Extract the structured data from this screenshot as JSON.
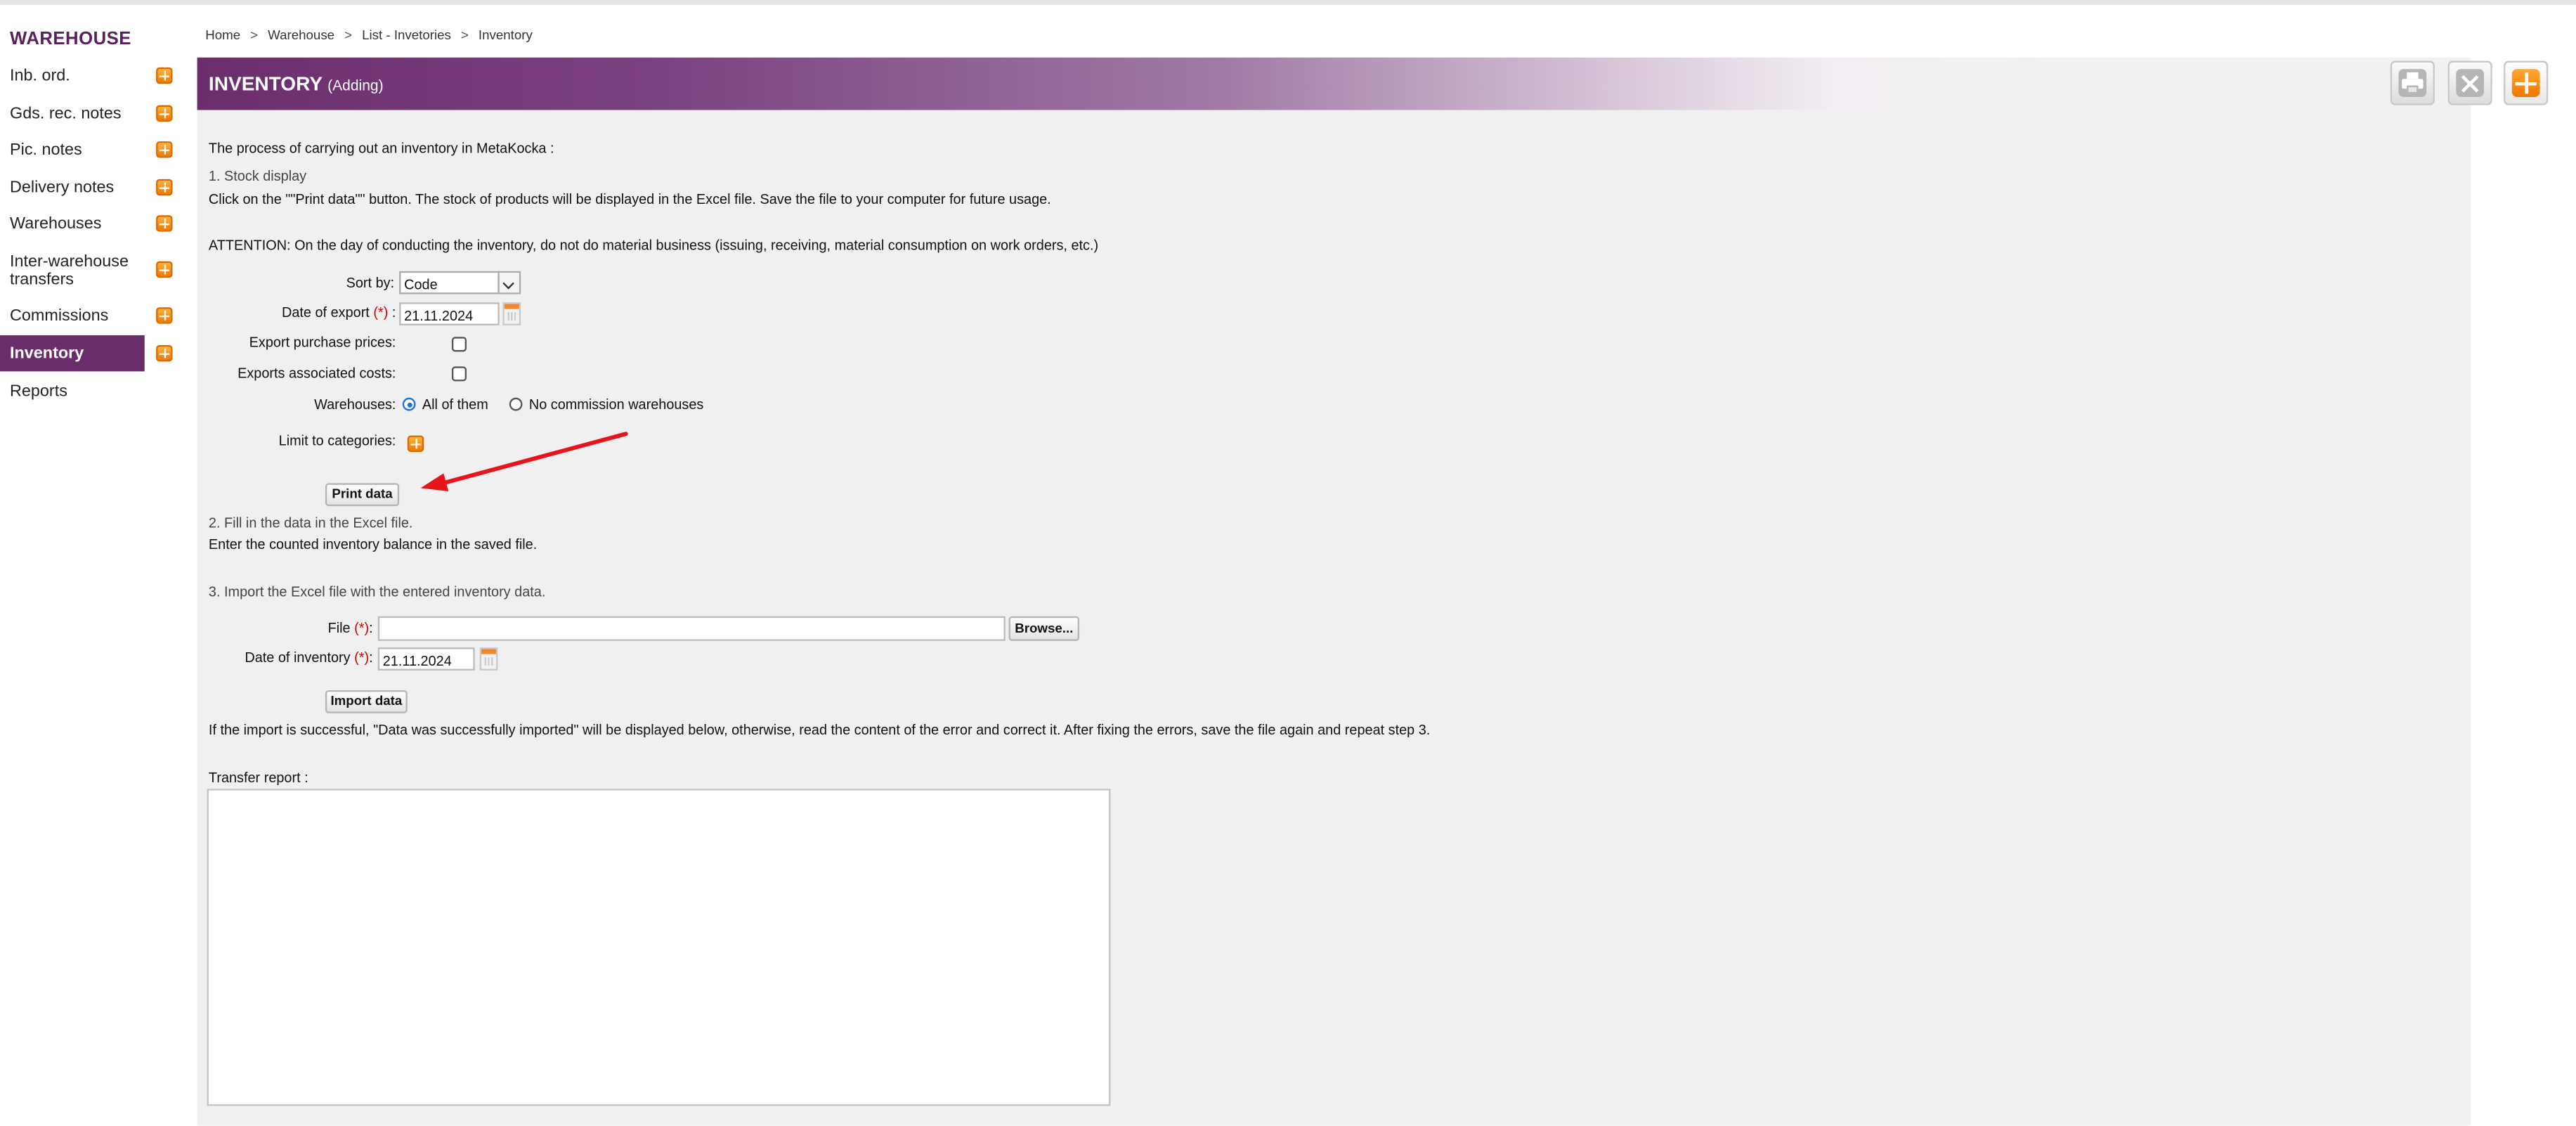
{
  "sidebar": {
    "title": "WAREHOUSE",
    "items": [
      {
        "label": "Inb. ord.",
        "has_add": true
      },
      {
        "label": "Gds. rec. notes",
        "has_add": true
      },
      {
        "label": "Pic. notes",
        "has_add": true
      },
      {
        "label": "Delivery notes",
        "has_add": true
      },
      {
        "label": "Warehouses",
        "has_add": true
      },
      {
        "label": "Inter-warehouse",
        "label2": "transfers",
        "has_add": true
      },
      {
        "label": "Commissions",
        "has_add": true
      },
      {
        "label": "Inventory",
        "has_add": true,
        "active": true
      },
      {
        "label": "Reports",
        "has_add": false
      }
    ]
  },
  "breadcrumb": {
    "items": [
      "Home",
      "Warehouse",
      "List - Invetories",
      "Inventory"
    ],
    "separator": ">"
  },
  "header": {
    "title": "INVENTORY",
    "subtitle": "(Adding)"
  },
  "toolbar": {
    "buttons": [
      "printer-icon",
      "close-icon",
      "add-icon"
    ]
  },
  "content": {
    "intro": "The process of carrying out an inventory in MetaKocka :",
    "step1_title": "1. Stock display",
    "step1_text": "Click on the \"\"Print data\"\" button. The stock of products will be displayed in the Excel file. Save the file to your computer for future usage.",
    "attention": "ATTENTION: On the day of conducting the inventory, do not do material business (issuing, receiving, material consumption on work orders, etc.)",
    "step2_title": "2. Fill in the data in the Excel file.",
    "step2_text": "Enter the counted inventory balance in the saved file.",
    "step3_title": "3. Import the Excel file with the entered inventory data.",
    "import_note": "If the import is successful, \"Data was successfully imported\" will be displayed below, otherwise, read the content of the error and correct it. After fixing the errors, save the file again and repeat step 3.",
    "transfer_report_label": "Transfer report :"
  },
  "form": {
    "sort_by_label": "Sort by:",
    "sort_by_value": "Code",
    "date_of_export_label": "Date of export",
    "date_of_export_value": "21.11.2024",
    "required_mark": "(*)",
    "colon_spaced": " :",
    "colon": ":",
    "export_purchase_prices_label": "Export purchase prices:",
    "export_purchase_prices_checked": false,
    "exports_associated_costs_label": "Exports associated costs:",
    "exports_associated_costs_checked": false,
    "warehouses_label": "Warehouses:",
    "warehouses_options": [
      "All of them",
      "No commission warehouses"
    ],
    "warehouses_selected": "All of them",
    "limit_categories_label": "Limit to categories:",
    "print_button": "Print data",
    "file_label": "File",
    "file_value": "",
    "browse_button": "Browse...",
    "date_of_inventory_label": "Date of inventory",
    "date_of_inventory_value": "21.11.2024",
    "import_button": "Import data"
  },
  "colors": {
    "brand_purple": "#6b2e6d",
    "accent_orange": "#f07a00",
    "annotation_arrow": "#e8141c",
    "required": "#d00000"
  }
}
